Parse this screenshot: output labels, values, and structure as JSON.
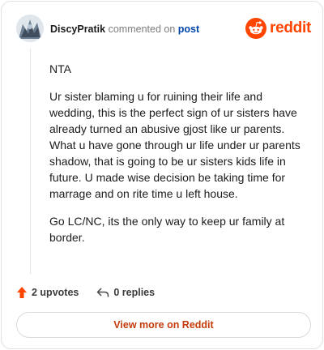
{
  "comment": {
    "username": "DiscyPratik",
    "action_text": "commented on",
    "target_link": "post",
    "paragraphs": [
      "NTA",
      "Ur sister blaming u for ruining their life and wedding, this is the perfect sign of ur sisters have already turned an abusive gjost like ur parents. What u have gone through ur life under ur parents shadow, that is going to be ur sisters kids life in future. U made wise decision be taking time for marrage and on rite time u left house.",
      "Go LC/NC, its the only way to keep ur family at border."
    ]
  },
  "brand": {
    "name": "reddit",
    "color": "#ff4500"
  },
  "actions": {
    "upvotes_label": "2 upvotes",
    "replies_label": "0 replies"
  },
  "footer": {
    "view_more_label": "View more on Reddit"
  },
  "colors": {
    "accent": "#ff4500",
    "link": "#0045ac",
    "view_more_text": "#c43b0c"
  },
  "icons": [
    "avatar",
    "reddit-logo-icon",
    "upvote-arrow-icon",
    "reply-arrow-icon"
  ]
}
